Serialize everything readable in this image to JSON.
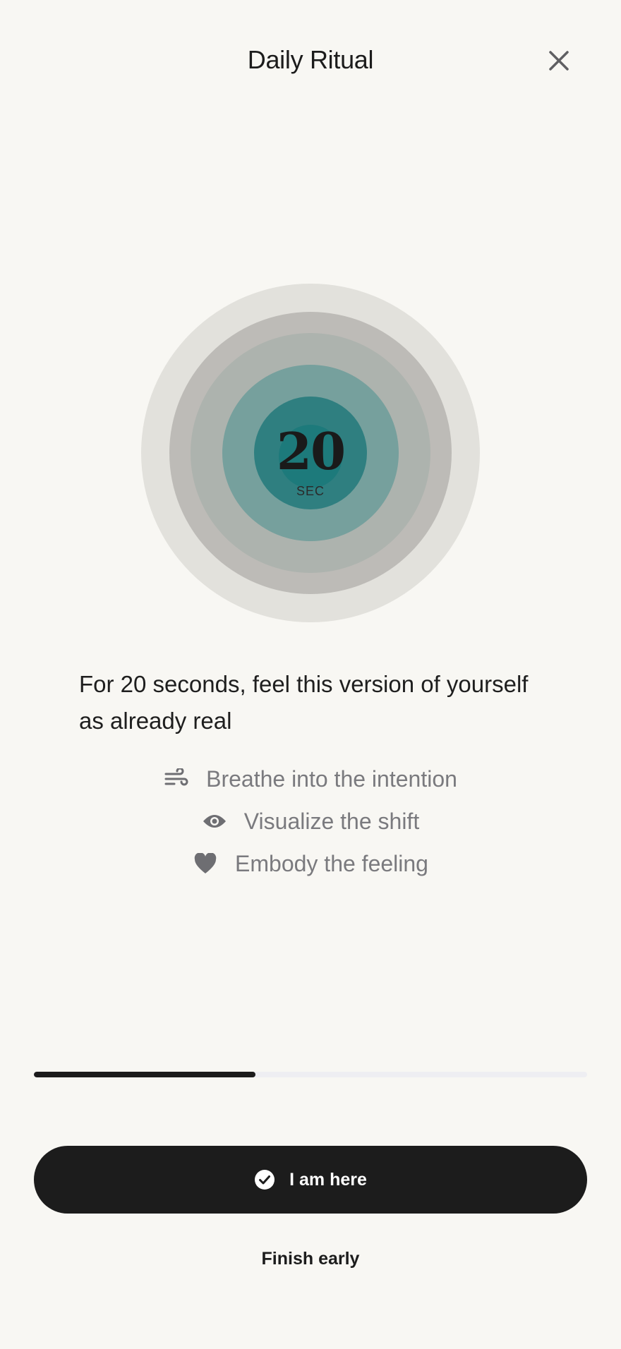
{
  "header": {
    "title": "Daily Ritual",
    "close_icon": "close-icon"
  },
  "timer": {
    "value": "20",
    "unit": "SEC"
  },
  "prompt": "For 20 seconds, feel this version of yourself as already real",
  "steps": [
    {
      "icon": "wind-icon",
      "label": "Breathe into the intention"
    },
    {
      "icon": "eye-icon",
      "label": "Visualize the shift"
    },
    {
      "icon": "heart-icon",
      "label": "Embody the feeling"
    }
  ],
  "progress": {
    "fraction": 0.4
  },
  "actions": {
    "primary_label": "I am here",
    "primary_icon": "check-circle-icon",
    "secondary_label": "Finish early"
  },
  "colors": {
    "background": "#f8f7f3",
    "primary": "#1c1c1c",
    "accent_teal": "#2f7f80",
    "muted_text": "#7a7a7e"
  }
}
